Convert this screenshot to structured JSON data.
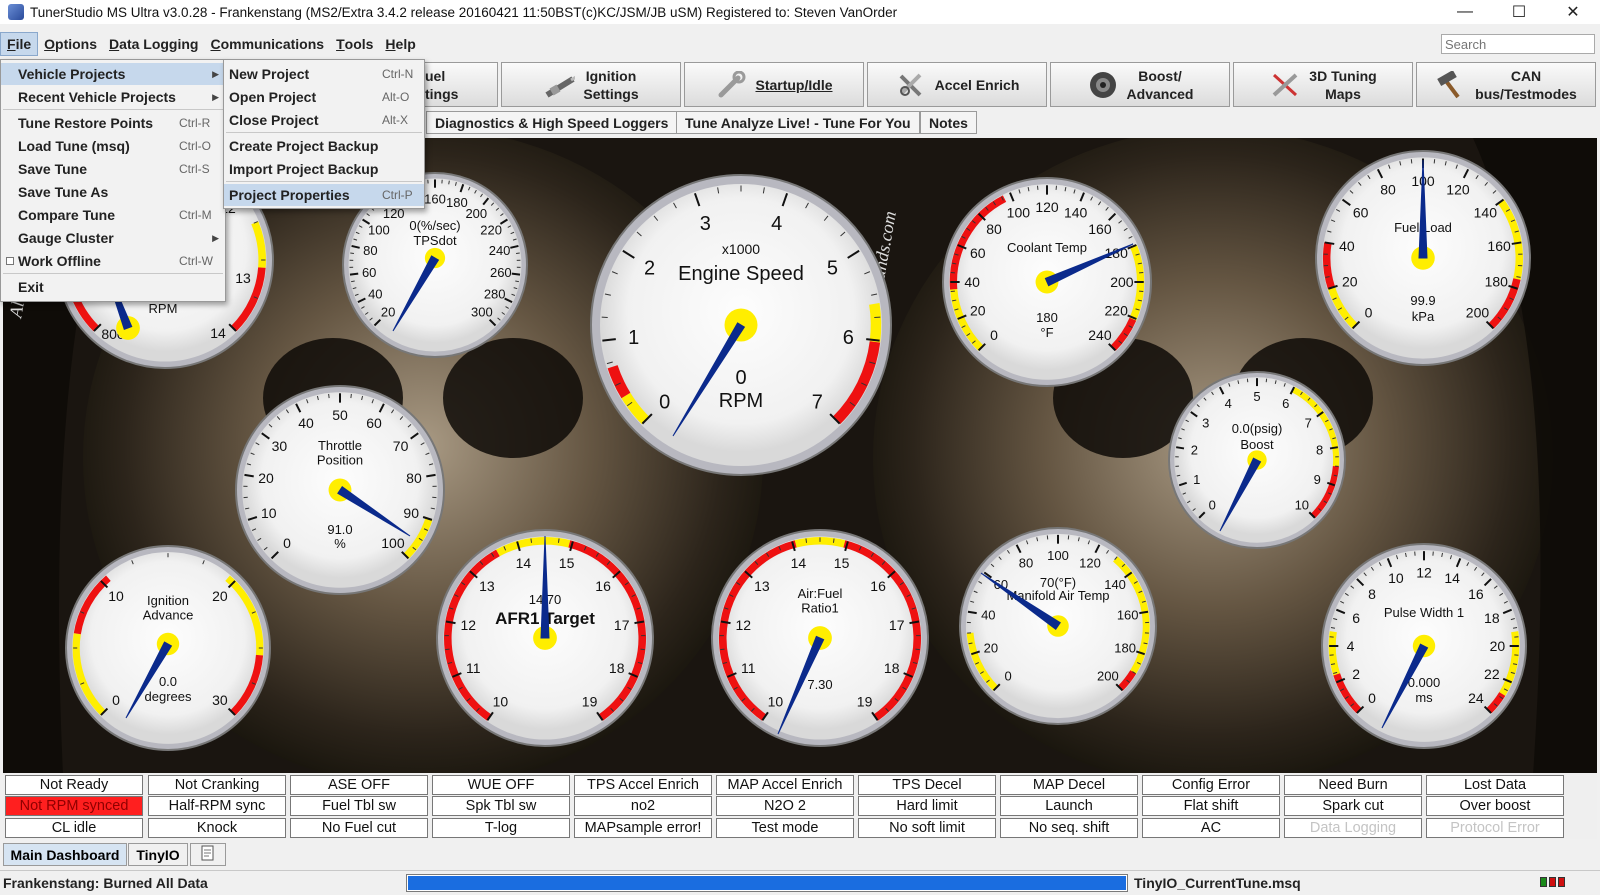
{
  "window": {
    "title": "TunerStudio MS Ultra v3.0.28 - Frankenstang (MS2/Extra 3.4.2 release  20160421 11:50BST(c)KC/JSM/JB   uSM) Registered to: Steven VanOrder",
    "minimize": "—",
    "maximize": "☐",
    "close": "✕"
  },
  "menubar": {
    "items": [
      {
        "underline": "F",
        "rest": "ile"
      },
      {
        "underline": "O",
        "rest": "ptions"
      },
      {
        "underline": "D",
        "rest": "ata Logging"
      },
      {
        "underline": "C",
        "rest": "ommunications"
      },
      {
        "underline": "T",
        "rest": "ools"
      },
      {
        "underline": "H",
        "rest": "elp"
      }
    ],
    "search_placeholder": "Search"
  },
  "toolbar": {
    "partial_label": "uel\ntings",
    "buttons": [
      {
        "label": "Ignition\nSettings",
        "icon": "spark-plug-icon"
      },
      {
        "label": "Startup/Idle",
        "icon": "wrench-icon"
      },
      {
        "label": "Accel Enrich",
        "icon": "tools-icon"
      },
      {
        "label": "Boost/\nAdvanced",
        "icon": "turbo-icon"
      },
      {
        "label": "3D Tuning\nMaps",
        "icon": "tuning-tools-icon"
      },
      {
        "label": "CAN\nbus/Testmodes",
        "icon": "hammer-icon"
      }
    ]
  },
  "subtabs": [
    "Diagnostics & High Speed Loggers",
    "Tune Analyze Live! - Tune For You",
    "Notes"
  ],
  "file_menu": {
    "items": [
      {
        "label": "Vehicle Projects",
        "accel": "",
        "submenu": true,
        "highlight": true
      },
      {
        "label": "Recent Vehicle Projects",
        "accel": "",
        "submenu": true
      },
      {
        "label": "Tune Restore Points",
        "accel": "Ctrl-R"
      },
      {
        "label": "Load Tune (msq)",
        "accel": "Ctrl-O"
      },
      {
        "label": "Save Tune",
        "accel": "Ctrl-S"
      },
      {
        "label": "Save Tune As",
        "accel": ""
      },
      {
        "label": "Compare Tune",
        "accel": "Ctrl-M"
      },
      {
        "label": "Gauge Cluster",
        "accel": "",
        "submenu": true
      },
      {
        "label": "Work Offline",
        "accel": "Ctrl-W",
        "checkbox": true
      },
      {
        "label": "Exit",
        "accel": ""
      }
    ]
  },
  "vehicle_submenu": {
    "items": [
      {
        "label": "New Project",
        "accel": "Ctrl-N"
      },
      {
        "label": "Open Project",
        "accel": "Alt-O"
      },
      {
        "label": "Close Project",
        "accel": "Alt-X"
      },
      {
        "label": "Create Project Backup",
        "accel": ""
      },
      {
        "label": "Import Project Backup",
        "accel": ""
      },
      {
        "label": "Project Properties",
        "accel": "Ctrl-P",
        "highlight": true
      }
    ]
  },
  "background_watermark": "grounds.com",
  "background_watermark_left": "All",
  "gauges": [
    {
      "id": "rpm-small",
      "title": "",
      "value": "0",
      "units": "RPM",
      "tick_labels": [
        "13",
        "14",
        "800",
        "12"
      ]
    },
    {
      "id": "tpsdot",
      "title": "TPSdot",
      "value": "0(%/sec)",
      "units": "",
      "tick_labels": [
        "20",
        "40",
        "60",
        "80",
        "100",
        "120",
        "140",
        "160",
        "180",
        "200",
        "220",
        "240",
        "260",
        "280",
        "300"
      ]
    },
    {
      "id": "engine-speed",
      "title": "Engine Speed",
      "value": "0",
      "units": "RPM",
      "multiplier": "x1000",
      "tick_labels": [
        "0",
        "1",
        "2",
        "3",
        "4",
        "5",
        "6",
        "7"
      ]
    },
    {
      "id": "coolant",
      "title": "Coolant Temp",
      "value": "180",
      "units": "°F",
      "tick_labels": [
        "0",
        "20",
        "40",
        "60",
        "80",
        "100",
        "120",
        "140",
        "160",
        "180",
        "200",
        "220",
        "240"
      ]
    },
    {
      "id": "fuel-load",
      "title": "Fuel Load",
      "value": "99.9",
      "units": "kPa",
      "tick_labels": [
        "0",
        "20",
        "40",
        "60",
        "80",
        "100",
        "120",
        "140",
        "160",
        "180",
        "200"
      ]
    },
    {
      "id": "throttle",
      "title": "Throttle\nPosition",
      "value": "91.0",
      "units": "%",
      "tick_labels": [
        "0",
        "10",
        "20",
        "30",
        "40",
        "50",
        "60",
        "70",
        "80",
        "90",
        "100"
      ]
    },
    {
      "id": "boost",
      "title": "Boost",
      "value": "0.0(psig)",
      "units": "",
      "tick_labels": [
        "0",
        "1",
        "2",
        "3",
        "4",
        "5",
        "6",
        "7",
        "8",
        "9",
        "10"
      ]
    },
    {
      "id": "ign-advance",
      "title": "Ignition\nAdvance",
      "value": "0.0",
      "units": "degrees",
      "tick_labels": [
        "0",
        "10",
        "20",
        "30"
      ]
    },
    {
      "id": "afr-target",
      "title": "AFR1 Target",
      "value": "14.70",
      "units": "",
      "tick_labels": [
        "10",
        "11",
        "12",
        "13",
        "14",
        "15",
        "16",
        "17",
        "18",
        "19"
      ]
    },
    {
      "id": "afr1",
      "title": "Air:Fuel\nRatio1",
      "value": "7.30",
      "units": "",
      "tick_labels": [
        "10",
        "11",
        "12",
        "13",
        "14",
        "15",
        "16",
        "17",
        "18",
        "19"
      ]
    },
    {
      "id": "mat",
      "title": "Manifold Air Temp",
      "value": "70(°F)",
      "units": "",
      "tick_labels": [
        "0",
        "20",
        "40",
        "60",
        "80",
        "100",
        "120",
        "140",
        "160",
        "180",
        "200"
      ]
    },
    {
      "id": "pulse-width",
      "title": "Pulse Width 1",
      "value": "0.000",
      "units": "ms",
      "tick_labels": [
        "0",
        "2",
        "4",
        "6",
        "8",
        "10",
        "12",
        "14",
        "16",
        "18",
        "20",
        "22",
        "24"
      ]
    }
  ],
  "indicators": [
    [
      "Not Ready",
      "Not Cranking",
      "ASE OFF",
      "WUE OFF",
      "TPS Accel Enrich",
      "MAP Accel Enrich",
      "TPS Decel",
      "MAP Decel",
      "Config Error",
      "Need Burn",
      "Lost Data"
    ],
    [
      "Not RPM synced",
      "Half-RPM sync",
      "Fuel Tbl sw",
      "Spk Tbl sw",
      "no2",
      "N2O 2",
      "Hard limit",
      "Launch",
      "Flat shift",
      "Spark cut",
      "Over boost"
    ],
    [
      "CL idle",
      "Knock",
      "No Fuel cut",
      "T-log",
      "MAPsample error!",
      "Test mode",
      "No soft limit",
      "No seq. shift",
      "AC",
      "Data Logging",
      "Protocol Error"
    ]
  ],
  "bottom_tabs": [
    "Main Dashboard",
    "TinyIO"
  ],
  "status": {
    "left": "Frankenstang: Burned All Data",
    "file": "TinyIO_CurrentTune.msq",
    "progress": 1.0
  },
  "colors": {
    "accent": "#1a6de0",
    "indicator_alert": "#ff1f1f",
    "gauge_red": "#ee1111",
    "gauge_yellow": "#ffee00",
    "needle": "#0b2a8c",
    "hub": "#ffee00"
  }
}
